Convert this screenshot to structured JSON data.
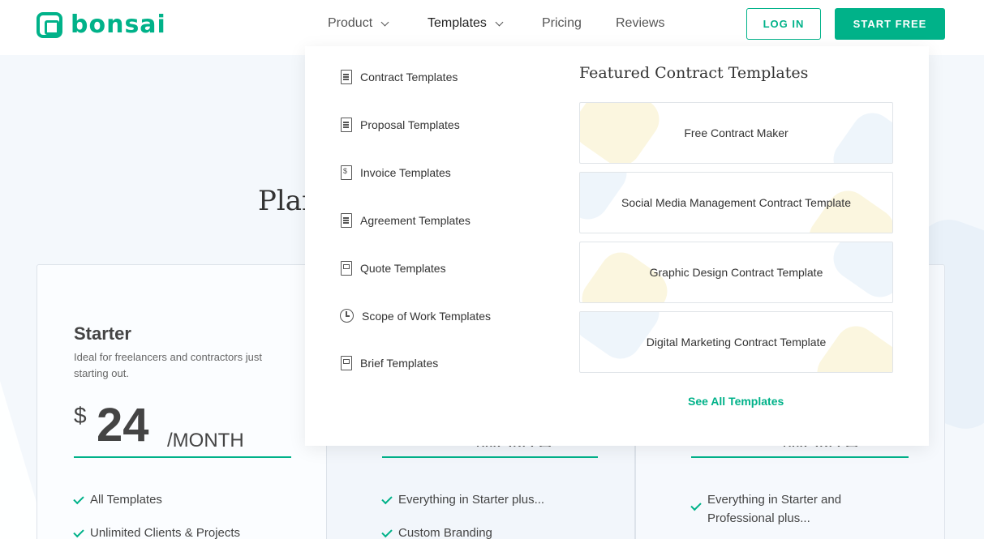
{
  "brand": {
    "name": "bonsai"
  },
  "nav": {
    "product": "Product",
    "templates": "Templates",
    "pricing": "Pricing",
    "reviews": "Reviews"
  },
  "header_buttons": {
    "login": "LOG IN",
    "start": "START FREE"
  },
  "page": {
    "title_partial": "Plan"
  },
  "dropdown": {
    "items": [
      {
        "label": "Contract Templates",
        "icon": "document-icon"
      },
      {
        "label": "Proposal Templates",
        "icon": "document-icon"
      },
      {
        "label": "Invoice Templates",
        "icon": "invoice-icon"
      },
      {
        "label": "Agreement Templates",
        "icon": "document-icon"
      },
      {
        "label": "Quote Templates",
        "icon": "quote-icon"
      },
      {
        "label": "Scope of Work Templates",
        "icon": "clock-icon"
      },
      {
        "label": "Brief Templates",
        "icon": "quote-icon"
      }
    ],
    "featured_title": "Featured Contract Templates",
    "featured": [
      "Free Contract Maker",
      "Social Media Management Contract Template",
      "Graphic Design Contract Template",
      "Digital Marketing Contract Template"
    ],
    "see_all": "See All Templates"
  },
  "plans": {
    "starter": {
      "name": "Starter",
      "description": "Ideal for freelancers and contractors just starting out.",
      "currency": "$",
      "price": "24",
      "period": "/MONTH",
      "features": [
        "All Templates",
        "Unlimited Clients & Projects"
      ]
    },
    "professional": {
      "period_partial": "/MONTH",
      "features": [
        "Everything in Starter plus...",
        "Custom Branding"
      ]
    },
    "business": {
      "period_partial": "/MONTH",
      "features": [
        "Everything in Starter and Professional plus..."
      ]
    }
  },
  "colors": {
    "accent": "#00b289"
  }
}
